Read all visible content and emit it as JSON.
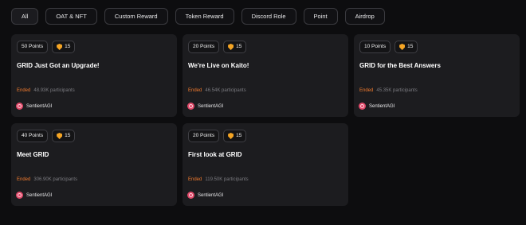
{
  "filters": [
    {
      "label": "All"
    },
    {
      "label": "OAT & NFT"
    },
    {
      "label": "Custom Reward"
    },
    {
      "label": "Token Reward"
    },
    {
      "label": "Discord Role"
    },
    {
      "label": "Point"
    },
    {
      "label": "Airdrop"
    }
  ],
  "cards": [
    {
      "points": "50 Points",
      "count": "15",
      "title": "GRID Just Got an Upgrade!",
      "status": "Ended",
      "participants": "48.93K participants",
      "creator": "SentientAGI"
    },
    {
      "points": "20 Points",
      "count": "15",
      "title": "We're Live on Kaito!",
      "status": "Ended",
      "participants": "46.54K participants",
      "creator": "SentientAGI"
    },
    {
      "points": "10 Points",
      "count": "15",
      "title": "GRID for the Best Answers",
      "status": "Ended",
      "participants": "45.35K participants",
      "creator": "SentientAGI"
    },
    {
      "points": "40 Points",
      "count": "15",
      "title": "Meet GRID",
      "status": "Ended",
      "participants": "306.90K participants",
      "creator": "SentientAGI"
    },
    {
      "points": "20 Points",
      "count": "15",
      "title": "First look at GRID",
      "status": "Ended",
      "participants": "119.50K participants",
      "creator": "SentientAGI"
    }
  ],
  "colors": {
    "ended": "#f07a2e",
    "badge_icon": "#f5a524",
    "avatar": "#e04a6a"
  },
  "icons": {
    "badge": "shield-icon",
    "creator": "avatar-icon"
  }
}
